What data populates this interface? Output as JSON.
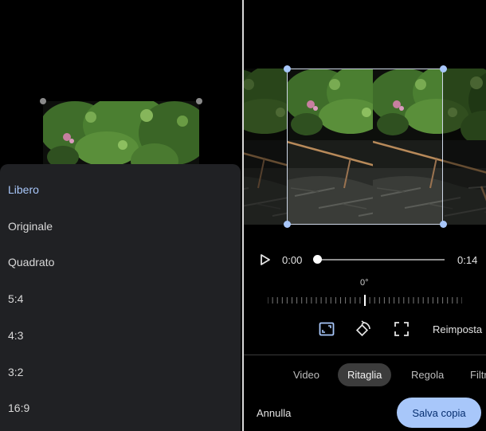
{
  "aspect_sheet": {
    "options": [
      {
        "label": "Libero",
        "selected": true
      },
      {
        "label": "Originale",
        "selected": false
      },
      {
        "label": "Quadrato",
        "selected": false
      },
      {
        "label": "5:4",
        "selected": false
      },
      {
        "label": "4:3",
        "selected": false
      },
      {
        "label": "3:2",
        "selected": false
      },
      {
        "label": "16:9",
        "selected": false
      }
    ]
  },
  "player": {
    "current_time": "0:00",
    "total_time": "0:14",
    "progress": 0
  },
  "rotation": {
    "angle_label": "0°"
  },
  "tools": {
    "aspect_icon": "aspect-ratio-icon",
    "rotate_icon": "rotate-icon",
    "perspective_icon": "perspective-crop-icon",
    "reset_label": "Reimposta"
  },
  "tabs": [
    {
      "label": "Video",
      "active": false
    },
    {
      "label": "Ritaglia",
      "active": true
    },
    {
      "label": "Regola",
      "active": false
    },
    {
      "label": "Filtr",
      "active": false
    }
  ],
  "actions": {
    "cancel_label": "Annulla",
    "save_label": "Salva copia"
  },
  "colors": {
    "accent": "#a8c7fa",
    "sheet_bg": "#202124",
    "tab_active_bg": "#3c3c3c"
  }
}
